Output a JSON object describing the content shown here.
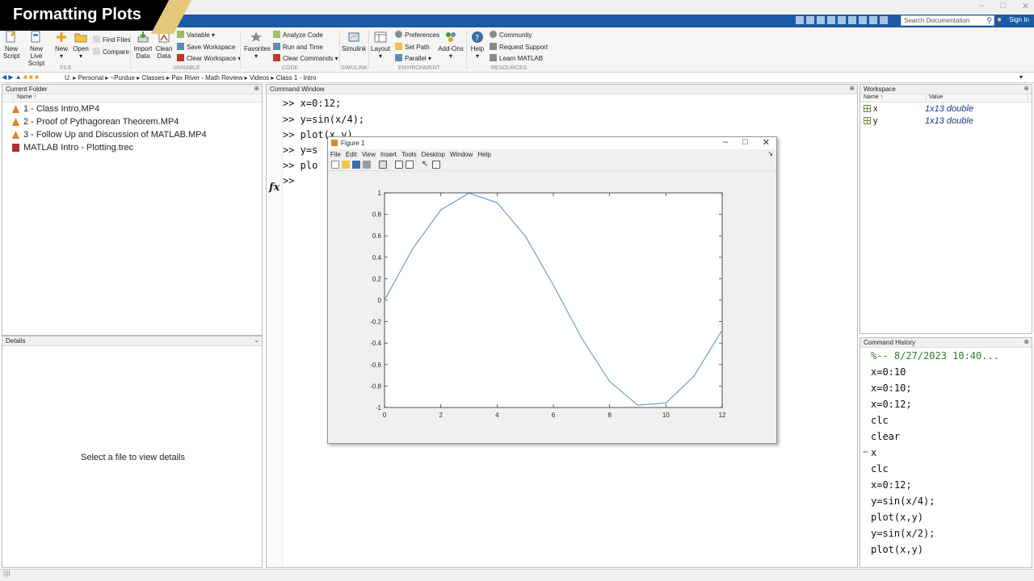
{
  "overlay_title": "Formatting Plots",
  "toolstrip": {
    "search_placeholder": "Search Documentation",
    "sign_in": "Sign In"
  },
  "ribbon": {
    "file": {
      "section": "FILE",
      "new_script_1": "New",
      "new_script_2": "Script",
      "new_live_1": "New",
      "new_live_2": "Live Script",
      "new": "New",
      "open": "Open",
      "find_files": "Find Files",
      "compare": "Compare"
    },
    "variable": {
      "section": "VARIABLE",
      "import_1": "Import",
      "import_2": "Data",
      "clean_1": "Clean",
      "clean_2": "Data",
      "variable": "Variable",
      "save_workspace": "Save Workspace",
      "clear_workspace": "Clear Workspace"
    },
    "code": {
      "section": "CODE",
      "favorites": "Favorites",
      "analyze_code": "Analyze Code",
      "run_and_time": "Run and Time",
      "clear_commands": "Clear Commands"
    },
    "simulink": {
      "section": "SIMULINK",
      "label": "Simulink"
    },
    "environment": {
      "section": "ENVIRONMENT",
      "layout": "Layout",
      "preferences": "Preferences",
      "set_path": "Set Path",
      "parallel": "Parallel",
      "add_ons": "Add-Ons"
    },
    "resources": {
      "section": "RESOURCES",
      "help": "Help",
      "community": "Community",
      "request_support": "Request Support",
      "learn_matlab": "Learn MATLAB"
    }
  },
  "address": {
    "path": "U: ▸ Personal ▸ ~Purdue ▸ Classes ▸ Pax River - Math Review ▸ Videos ▸ Class 1 - Intro"
  },
  "current_folder": {
    "title": "Current Folder",
    "col_name": "Name ↑",
    "files": [
      {
        "name": "1 - Class Intro.MP4",
        "icon": "vlc-cone-icon",
        "color": "#e67e22"
      },
      {
        "name": "2 - Proof of Pythagorean Theorem.MP4",
        "icon": "vlc-cone-icon",
        "color": "#e67e22"
      },
      {
        "name": "3 - Follow Up and Discussion of MATLAB.MP4",
        "icon": "vlc-cone-icon",
        "color": "#e67e22"
      },
      {
        "name": "MATLAB Intro - Plotting.trec",
        "icon": "trec-file-icon",
        "color": "#b03030"
      }
    ]
  },
  "details": {
    "title": "Details",
    "message": "Select a file to view details"
  },
  "command_window": {
    "title": "Command Window",
    "lines": [
      ">> x=0:12;",
      ">> y=sin(x/4);",
      ">> plot(x,y)",
      ">> y=s",
      ">> plo",
      ">> "
    ]
  },
  "workspace": {
    "title": "Workspace",
    "col_name": "Name ↑",
    "col_value": "Value",
    "vars": [
      {
        "name": "x",
        "value": "1x13 double"
      },
      {
        "name": "y",
        "value": "1x13 double"
      }
    ]
  },
  "command_history": {
    "title": "Command History",
    "lines": [
      "%-- 8/27/2023 10:40...",
      "x=0:10",
      "x=0:10;",
      "x=0:12;",
      "clc",
      "clear",
      "x",
      "clc",
      "x=0:12;",
      "y=sin(x/4);",
      "plot(x,y)",
      "y=sin(x/2);",
      "plot(x,y)"
    ]
  },
  "figure": {
    "title": "Figure 1",
    "menu": [
      "File",
      "Edit",
      "View",
      "Insert",
      "Tools",
      "Desktop",
      "Window",
      "Help"
    ]
  },
  "chart_data": {
    "type": "line",
    "title": "",
    "xlabel": "",
    "ylabel": "",
    "xlim": [
      0,
      12
    ],
    "ylim": [
      -1,
      1
    ],
    "xticks": [
      0,
      2,
      4,
      6,
      8,
      10,
      12
    ],
    "yticks": [
      -1,
      -0.8,
      -0.6,
      -0.4,
      -0.2,
      0,
      0.2,
      0.4,
      0.6,
      0.8,
      1
    ],
    "ytick_labels": [
      "-1",
      "-0.8",
      "-0.6",
      "-0.4",
      "-0.2",
      "0",
      "0.2",
      "0.4",
      "0.6",
      "0.8",
      "1"
    ],
    "grid": false,
    "line_color": "#5b8db8",
    "series": [
      {
        "x": [
          0,
          1,
          2,
          3,
          4,
          5,
          6,
          7,
          8,
          9,
          10,
          11,
          12
        ],
        "values": [
          0,
          0.479,
          0.841,
          0.997,
          0.909,
          0.598,
          0.141,
          -0.351,
          -0.757,
          -0.978,
          -0.959,
          -0.706,
          -0.279
        ]
      }
    ]
  }
}
